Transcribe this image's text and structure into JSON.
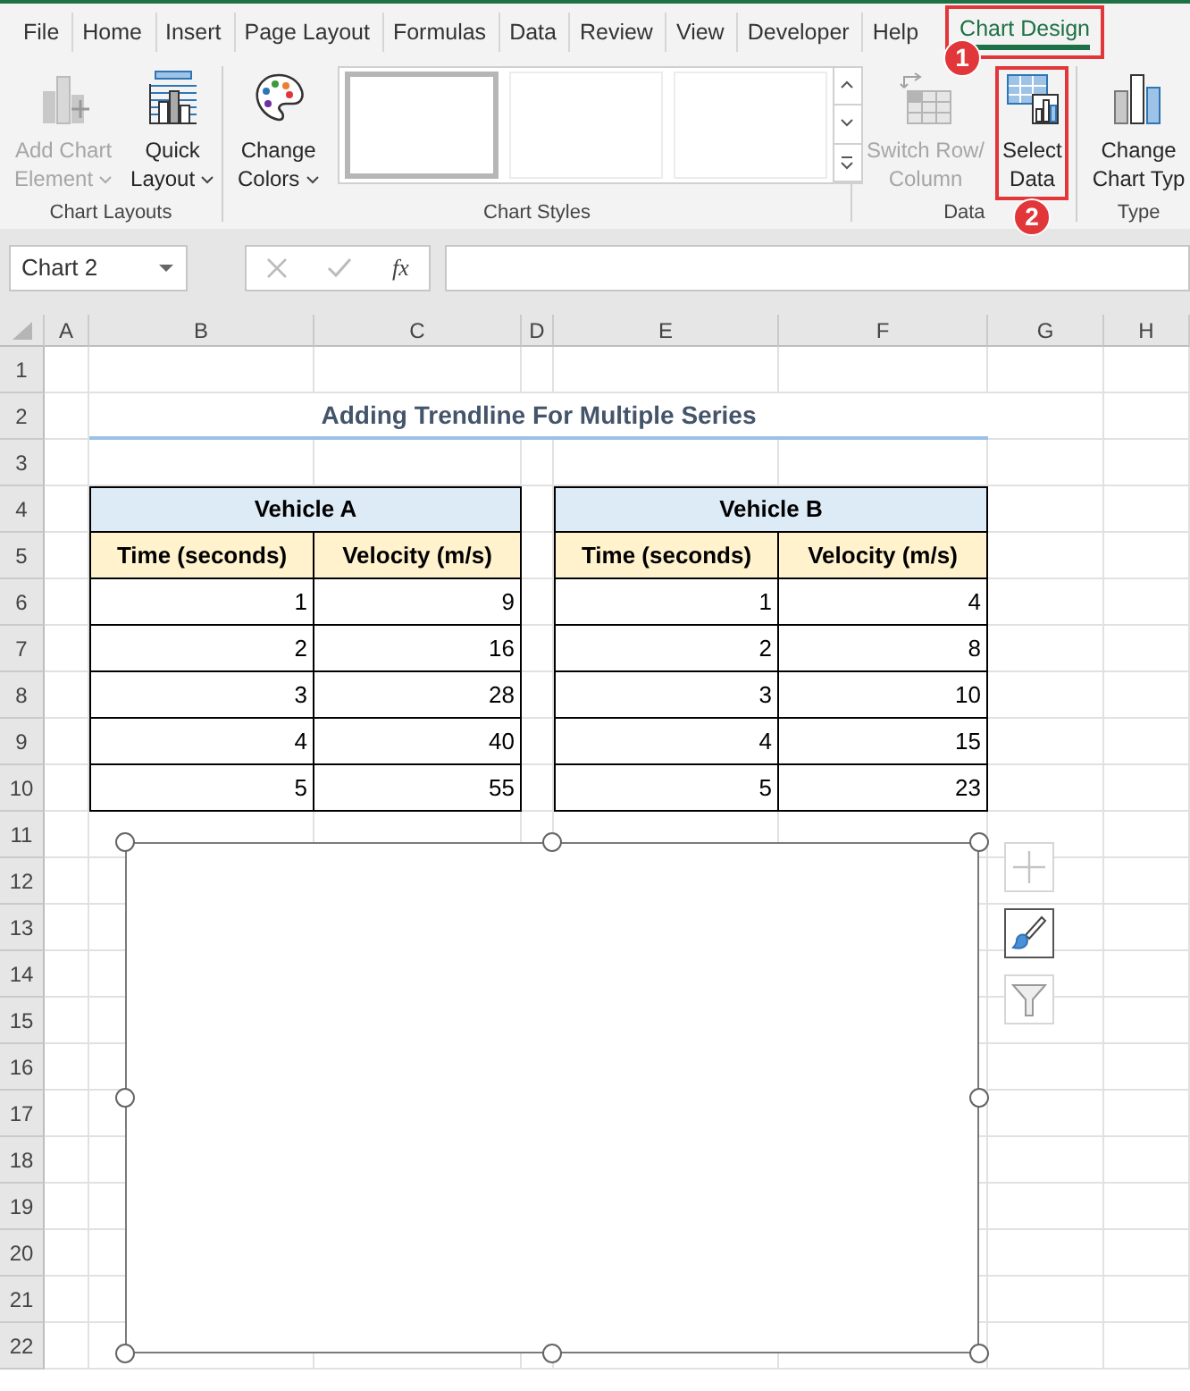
{
  "ribbon_tabs": [
    {
      "label": "File",
      "selected": false,
      "highlighted": false
    },
    {
      "label": "Home",
      "selected": false,
      "highlighted": false
    },
    {
      "label": "Insert",
      "selected": false,
      "highlighted": false
    },
    {
      "label": "Page Layout",
      "selected": false,
      "highlighted": false
    },
    {
      "label": "Formulas",
      "selected": false,
      "highlighted": false
    },
    {
      "label": "Data",
      "selected": false,
      "highlighted": false
    },
    {
      "label": "Review",
      "selected": false,
      "highlighted": false
    },
    {
      "label": "View",
      "selected": false,
      "highlighted": false
    },
    {
      "label": "Developer",
      "selected": false,
      "highlighted": false
    },
    {
      "label": "Help",
      "selected": false,
      "highlighted": false
    },
    {
      "label": "Chart Design",
      "selected": true,
      "highlighted": true
    }
  ],
  "ribbon_groups": [
    {
      "label": "Chart Layouts",
      "commands": [
        {
          "kind": "add_element",
          "lines": [
            "Add Chart",
            "Element"
          ],
          "dropdown": true,
          "disabled": true,
          "highlighted": false
        },
        {
          "kind": "quick_layout",
          "lines": [
            "Quick",
            "Layout"
          ],
          "dropdown": true,
          "disabled": false,
          "highlighted": false
        }
      ]
    },
    {
      "label": "Chart Styles",
      "commands": [
        {
          "kind": "colors",
          "lines": [
            "Change",
            "Colors"
          ],
          "dropdown": true,
          "disabled": false,
          "highlighted": false
        }
      ],
      "gallery": [
        {
          "selected": true
        },
        {
          "selected": false
        },
        {
          "selected": false
        }
      ]
    },
    {
      "label": "Data",
      "commands": [
        {
          "kind": "switch",
          "lines": [
            "Switch Row/",
            "Column"
          ],
          "dropdown": false,
          "disabled": true,
          "highlighted": false
        },
        {
          "kind": "select_data",
          "lines": [
            "Select",
            "Data"
          ],
          "dropdown": false,
          "disabled": false,
          "highlighted": true
        }
      ]
    },
    {
      "label": "Type",
      "commands": [
        {
          "kind": "chart_type",
          "lines": [
            "Change",
            "Chart Typ"
          ],
          "dropdown": false,
          "disabled": false,
          "highlighted": false
        }
      ]
    }
  ],
  "annotations": [
    {
      "number": "1"
    },
    {
      "number": "2"
    }
  ],
  "formula_bar": {
    "name_box": "Chart 2",
    "function_label": "fx"
  },
  "sheet": {
    "columns": [
      "A",
      "B",
      "C",
      "D",
      "E",
      "F",
      "G",
      "H"
    ],
    "rows": [
      "1",
      "2",
      "3",
      "4",
      "5",
      "6",
      "7",
      "8",
      "9",
      "10",
      "11",
      "12",
      "13",
      "14",
      "15",
      "16",
      "17",
      "18",
      "19",
      "20",
      "21",
      "22"
    ],
    "title": "Adding Trendline For Multiple Series",
    "tables": [
      {
        "title": "Vehicle A",
        "headers": [
          "Time (seconds)",
          "Velocity (m/s)"
        ],
        "rows": [
          [
            "1",
            "9"
          ],
          [
            "2",
            "16"
          ],
          [
            "3",
            "28"
          ],
          [
            "4",
            "40"
          ],
          [
            "5",
            "55"
          ]
        ]
      },
      {
        "title": "Vehicle B",
        "headers": [
          "Time (seconds)",
          "Velocity (m/s)"
        ],
        "rows": [
          [
            "1",
            "4"
          ],
          [
            "2",
            "8"
          ],
          [
            "3",
            "10"
          ],
          [
            "4",
            "15"
          ],
          [
            "5",
            "23"
          ]
        ]
      }
    ]
  },
  "chart": {
    "buttons": [
      {
        "kind": "elements",
        "disabled": true,
        "selected": false
      },
      {
        "kind": "styles",
        "disabled": false,
        "selected": true
      },
      {
        "kind": "filters",
        "disabled": false,
        "selected": false
      }
    ]
  }
}
